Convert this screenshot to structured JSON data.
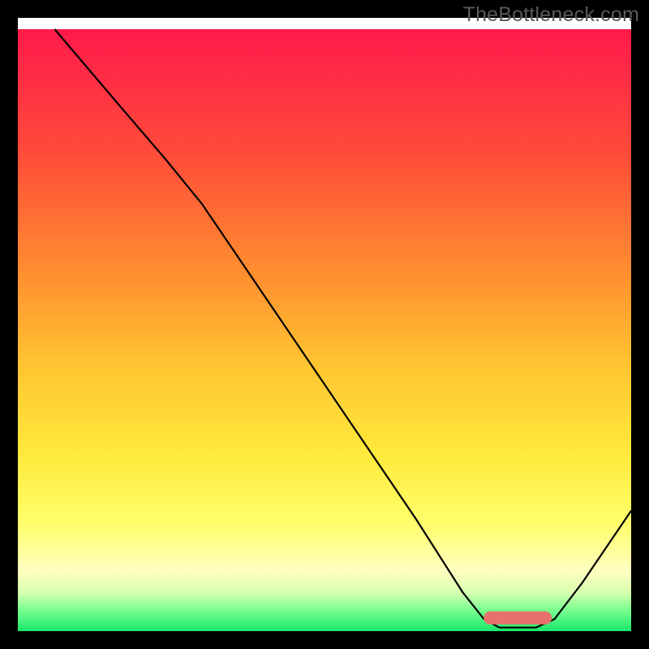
{
  "watermark": "TheBottleneck.com",
  "chart_data": {
    "type": "line",
    "title": "",
    "xlabel": "",
    "ylabel": "",
    "xlim": [
      0,
      100
    ],
    "ylim": [
      0,
      100
    ],
    "axes_visible": false,
    "grid": false,
    "gradient_background": {
      "stops": [
        {
          "offset": 0.0,
          "color": "#ff1a4b"
        },
        {
          "offset": 0.2,
          "color": "#ff4a3a"
        },
        {
          "offset": 0.4,
          "color": "#ff8c2f"
        },
        {
          "offset": 0.55,
          "color": "#ffc231"
        },
        {
          "offset": 0.7,
          "color": "#ffe83a"
        },
        {
          "offset": 0.82,
          "color": "#ffff6a"
        },
        {
          "offset": 0.9,
          "color": "#ffffc0"
        },
        {
          "offset": 0.935,
          "color": "#d9ffb0"
        },
        {
          "offset": 0.965,
          "color": "#7aff8f"
        },
        {
          "offset": 1.0,
          "color": "#17e86b"
        }
      ]
    },
    "series": [
      {
        "name": "curve",
        "stroke": "#000000",
        "stroke_width": 2.2,
        "points": [
          {
            "x": 6.0,
            "y": 100.0
          },
          {
            "x": 16.0,
            "y": 88.0
          },
          {
            "x": 24.0,
            "y": 78.5
          },
          {
            "x": 30.0,
            "y": 71.0
          },
          {
            "x": 50.0,
            "y": 41.0
          },
          {
            "x": 65.0,
            "y": 18.5
          },
          {
            "x": 72.5,
            "y": 6.5
          },
          {
            "x": 76.0,
            "y": 2.0
          },
          {
            "x": 78.5,
            "y": 0.6
          },
          {
            "x": 84.5,
            "y": 0.6
          },
          {
            "x": 87.5,
            "y": 2.0
          },
          {
            "x": 92.0,
            "y": 8.0
          },
          {
            "x": 100.0,
            "y": 20.0
          }
        ]
      }
    ],
    "marker": {
      "name": "bottleneck-marker",
      "x_start": 77.0,
      "x_end": 86.0,
      "y": 2.2,
      "color": "#e8716c",
      "thickness": 16,
      "cap": "round"
    },
    "frame": {
      "color": "#000000",
      "width": 22
    }
  }
}
